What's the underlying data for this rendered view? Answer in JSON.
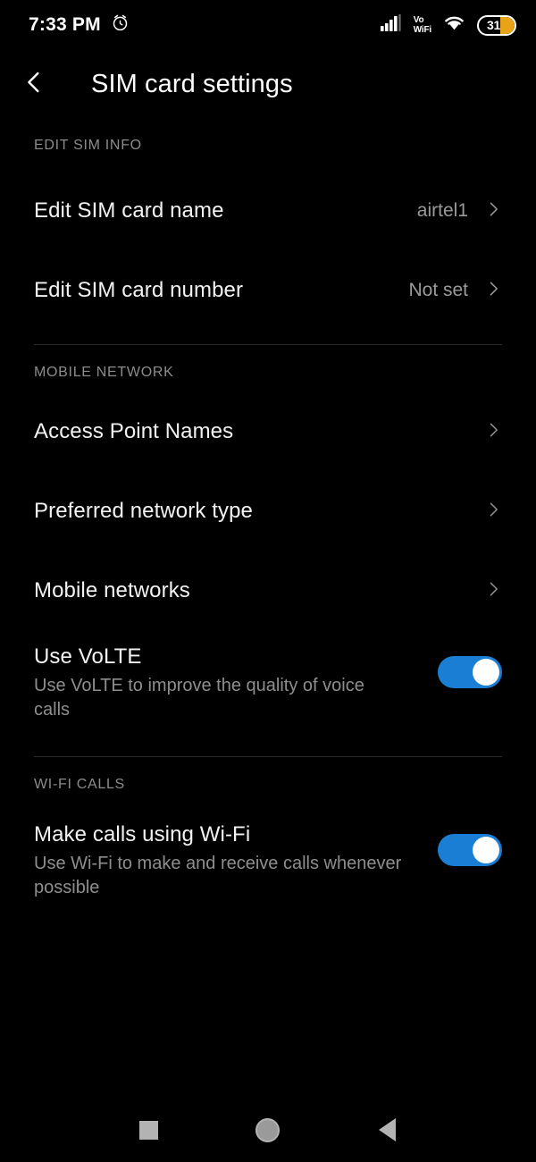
{
  "status_bar": {
    "time": "7:33 PM",
    "alarm_icon": "alarm-clock-icon",
    "signal_icon": "cellular-signal-icon",
    "volte_line1": "Vo",
    "volte_line2": "WiFi",
    "wifi_icon": "wifi-icon",
    "battery_level": "31",
    "battery_accent": "#e8a317"
  },
  "app_bar": {
    "back_icon": "back-chevron-icon",
    "title": "SIM card settings"
  },
  "sections": [
    {
      "header": "EDIT SIM INFO",
      "rows": [
        {
          "title": "Edit SIM card name",
          "value": "airtel1",
          "chevron": true
        },
        {
          "title": "Edit SIM card number",
          "value": "Not set",
          "chevron": true
        }
      ]
    },
    {
      "header": "MOBILE NETWORK",
      "rows": [
        {
          "title": "Access Point Names",
          "chevron": true
        },
        {
          "title": "Preferred network type",
          "chevron": true
        },
        {
          "title": "Mobile networks",
          "chevron": true
        },
        {
          "title": "Use VoLTE",
          "subtitle": "Use VoLTE to improve the quality of voice calls",
          "toggle": "on"
        }
      ]
    },
    {
      "header": "WI-FI CALLS",
      "rows": [
        {
          "title": "Make calls using Wi-Fi",
          "subtitle": "Use Wi-Fi to make and receive calls whenever possible",
          "toggle": "on"
        }
      ]
    }
  ],
  "nav_bar": {
    "recents_icon": "recents-square-icon",
    "home_icon": "home-circle-icon",
    "back_icon": "back-triangle-icon"
  },
  "colors": {
    "background": "#000000",
    "toggle_on": "#1a7fd4",
    "primary_text": "#f2f2f2",
    "secondary_text": "#8e8e8e",
    "section_header": "#8c8c8c"
  }
}
